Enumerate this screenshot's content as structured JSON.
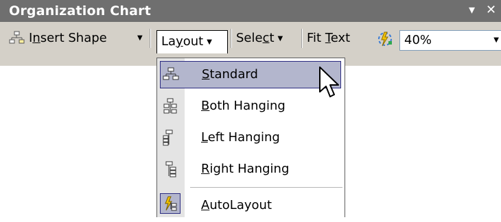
{
  "window": {
    "title": "Organization Chart",
    "dropdown_glyph": "▾",
    "close_glyph": "✕"
  },
  "toolbar": {
    "insert_shape": {
      "pre": "I",
      "key": "n",
      "post": "sert Shape",
      "icon": "insert-shape-icon"
    },
    "layout": {
      "pre": "La",
      "key": "y",
      "post": "out"
    },
    "select": {
      "pre": "Sele",
      "key": "c",
      "post": "t"
    },
    "fit_text": {
      "pre": "Fit ",
      "key": "T",
      "post": "ext"
    },
    "autoformat_icon": "autoformat-icon",
    "zoom": "40%"
  },
  "menu": {
    "items": [
      {
        "key": "S",
        "rest": "tandard",
        "icon": "layout-standard-icon",
        "highlighted": true
      },
      {
        "key": "B",
        "rest": "oth Hanging",
        "icon": "layout-both-hanging-icon"
      },
      {
        "key": "L",
        "rest": "eft Hanging",
        "icon": "layout-left-hanging-icon"
      },
      {
        "key": "R",
        "rest": "ight Hanging",
        "icon": "layout-right-hanging-icon"
      },
      {
        "key": "A",
        "rest": "utoLayout",
        "icon": "autolayout-icon",
        "checked": true
      }
    ]
  },
  "colors": {
    "title_bar": "#6f6f6f",
    "toolbar_bg": "#d4d0c8",
    "menu_highlight": "#b3b6cd",
    "menu_highlight_border": "#2a2a80"
  }
}
